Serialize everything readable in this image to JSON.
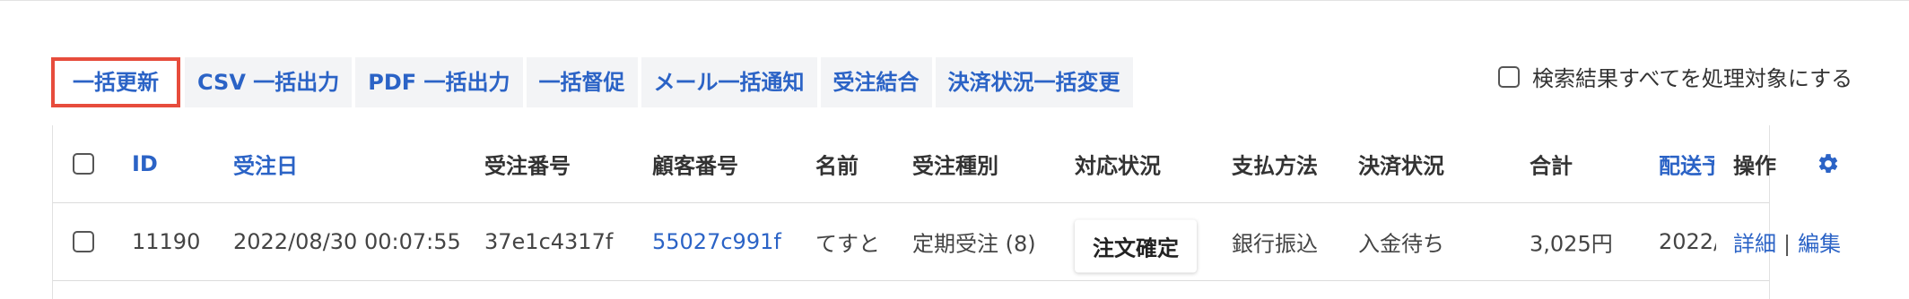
{
  "toolbar": {
    "buttons": [
      "一括更新",
      "CSV 一括出力",
      "PDF 一括出力",
      "一括督促",
      "メール一括通知",
      "受注結合",
      "決済状況一括変更"
    ]
  },
  "select_all": {
    "label": "検索結果すべてを処理対象にする",
    "checked": false
  },
  "table": {
    "headers": {
      "id": "ID",
      "order_date": "受注日",
      "order_no": "受注番号",
      "customer_no": "顧客番号",
      "name": "名前",
      "order_type": "受注種別",
      "status": "対応状況",
      "payment_method": "支払方法",
      "payment_status": "決済状況",
      "total": "合計",
      "shipping": "配送予",
      "actions": "操作"
    },
    "rows": [
      {
        "id": "11190",
        "order_date": "2022/08/30 00:07:55",
        "order_no": "37e1c4317f",
        "customer_no": "55027c991f",
        "name": "てすと",
        "order_type": "定期受注 (8)",
        "status": "注文確定",
        "payment_method": "銀行振込",
        "payment_status": "入金待ち",
        "total": "3,025円",
        "shipping": "2022/",
        "detail": "詳細",
        "separator": "|",
        "edit": "編集"
      }
    ]
  },
  "icons": {
    "settings": "gear-icon"
  },
  "colors": {
    "link": "#2b63c6",
    "highlight": "#e74c3c",
    "toolbar_bg": "#f3f4f6"
  }
}
